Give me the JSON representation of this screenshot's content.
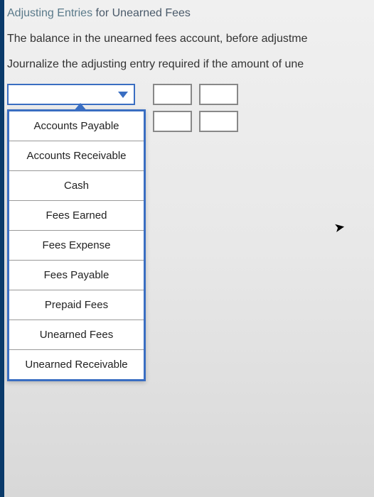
{
  "heading_prefix": "Adjusting Entries",
  "heading_suffix": " for Unearned Fees",
  "para1": "The balance in the unearned fees account, before adjustme",
  "para2": "Journalize the adjusting entry required if the amount of une",
  "dropdown": {
    "options": [
      "Accounts Payable",
      "Accounts Receivable",
      "Cash",
      "Fees Earned",
      "Fees Expense",
      "Fees Payable",
      "Prepaid Fees",
      "Unearned Fees",
      "Unearned Receivable"
    ]
  }
}
